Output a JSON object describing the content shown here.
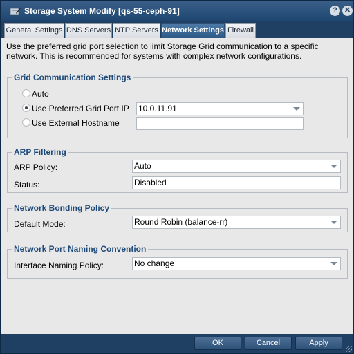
{
  "window": {
    "title": "Storage System Modify [qs-55-ceph-91]",
    "help_glyph": "?",
    "close_glyph": "✕"
  },
  "tabs": [
    {
      "label": "General Settings",
      "active": false
    },
    {
      "label": "DNS Servers",
      "active": false
    },
    {
      "label": "NTP Servers",
      "active": false
    },
    {
      "label": "Network Settings",
      "active": true
    },
    {
      "label": "Firewall",
      "active": false
    }
  ],
  "description": "Use the preferred grid port selection to limit Storage Grid communication to a specific network. This is recommended for systems with complex network configurations.",
  "grid_comm": {
    "legend": "Grid Communication Settings",
    "auto_label": "Auto",
    "preferred_label": "Use Preferred Grid Port IP",
    "preferred_value": "10.0.11.91",
    "external_label": "Use External Hostname",
    "external_value": "",
    "selected": "preferred"
  },
  "arp": {
    "legend": "ARP Filtering",
    "policy_label": "ARP Policy:",
    "policy_value": "Auto",
    "status_label": "Status:",
    "status_value": "Disabled"
  },
  "bonding": {
    "legend": "Network Bonding Policy",
    "mode_label": "Default Mode:",
    "mode_value": "Round Robin (balance-rr)"
  },
  "naming": {
    "legend": "Network Port Naming Convention",
    "policy_label": "Interface Naming Policy:",
    "policy_value": "No change"
  },
  "buttons": {
    "ok": "OK",
    "cancel": "Cancel",
    "apply": "Apply"
  },
  "colors": {
    "title_bar": "#2c5480",
    "active_tab": "#3d6896",
    "legend_text": "#1e4a7a",
    "content_bg": "#e8e8e8"
  },
  "icons": {
    "title": "storage-edit-icon",
    "help": "help-icon",
    "close": "close-icon",
    "dropdown": "chevron-down-icon",
    "resize": "resize-grip-icon"
  }
}
